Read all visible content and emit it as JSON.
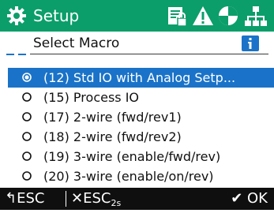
{
  "header": {
    "title": "Setup",
    "icons": [
      "gear-icon",
      "parameter-lock-icon",
      "warning-icon",
      "status-circle-icon",
      "network-icon"
    ]
  },
  "subheader": {
    "title": "Select Macro",
    "info_icon": "info-icon"
  },
  "macros": [
    {
      "label": "(12) Std IO with Analog Setp...",
      "selected": true
    },
    {
      "label": "(15) Process IO",
      "selected": false
    },
    {
      "label": "(17) 2-wire (fwd/rev1)",
      "selected": false
    },
    {
      "label": "(18) 2-wire (fwd/rev2)",
      "selected": false
    },
    {
      "label": "(19) 3-wire (enable/fwd/rev)",
      "selected": false
    },
    {
      "label": "(20) 3-wire (enable/on/rev)",
      "selected": false
    }
  ],
  "footer": {
    "esc": "ESC",
    "esc2": "ESC",
    "esc2_sub": "2s",
    "ok": "OK"
  },
  "colors": {
    "header_bg": "#0b9e6a",
    "selection": "#1a73c8",
    "footer_bg": "#0f0f0f"
  }
}
